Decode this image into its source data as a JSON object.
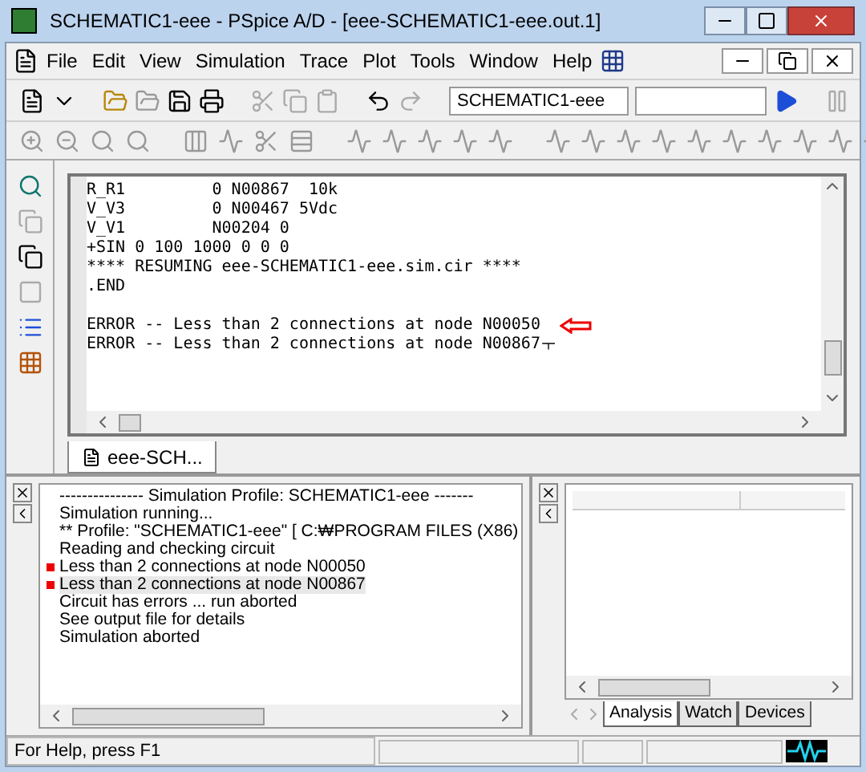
{
  "window": {
    "title": "SCHEMATIC1-eee - PSpice A/D  - [eee-SCHEMATIC1-eee.out.1]"
  },
  "menu": [
    "File",
    "Edit",
    "View",
    "Simulation",
    "Trace",
    "Plot",
    "Tools",
    "Window",
    "Help"
  ],
  "toolbar": {
    "profile_field": "SCHEMATIC1-eee"
  },
  "editor": {
    "blocks": [
      [
        {
          "text": "R_R1         0 N00867  10k",
          "arrow": false
        },
        {
          "text": "V_V3         0 N00467 5Vdc",
          "arrow": false
        },
        {
          "text": "V_V1         N00204 0",
          "arrow": false
        },
        {
          "text": "+SIN 0 100 1000 0 0 0",
          "arrow": false
        },
        {
          "text": "**** RESUMING eee-SCHEMATIC1-eee.sim.cir ****",
          "arrow": false
        },
        {
          "text": ".END",
          "arrow": false
        }
      ],
      [
        {
          "text": "ERROR -- Less than 2 connections at node N00050",
          "arrow": true
        },
        {
          "text": "ERROR -- Less than 2 connections at node N00867ㅜ",
          "arrow": false
        }
      ]
    ],
    "tab": "eee-SCH..."
  },
  "output": {
    "lines": [
      {
        "text": "--------------- Simulation Profile:  SCHEMATIC1-eee -------",
        "kind": "info",
        "selected": false
      },
      {
        "text": "Simulation running...",
        "kind": "info",
        "selected": false
      },
      {
        "text": "** Profile: \"SCHEMATIC1-eee\"  [ C:₩PROGRAM FILES (X86)",
        "kind": "info",
        "selected": false
      },
      {
        "text": "Reading and checking circuit",
        "kind": "info",
        "selected": false
      },
      {
        "text": "Less than 2 connections at node N00050",
        "kind": "error",
        "selected": false
      },
      {
        "text": "Less than 2 connections at node N00867",
        "kind": "error",
        "selected": true
      },
      {
        "text": "Circuit has errors ... run aborted",
        "kind": "info",
        "selected": false
      },
      {
        "text": "See output file for details",
        "kind": "info",
        "selected": false
      },
      {
        "text": "Simulation aborted",
        "kind": "info",
        "selected": false
      }
    ]
  },
  "side_tabs": [
    {
      "label": "Analysis",
      "selected": true
    },
    {
      "label": "Watch",
      "selected": false
    },
    {
      "label": "Devices",
      "selected": false
    }
  ],
  "status_bar": {
    "text": "For Help, press F1"
  }
}
